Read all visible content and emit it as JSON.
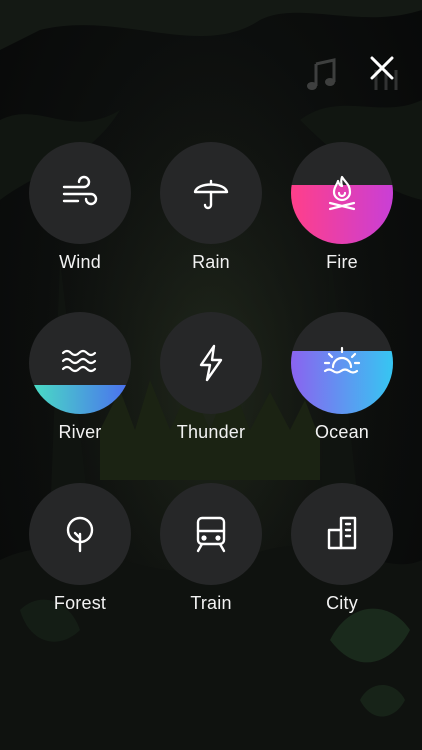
{
  "header": {
    "music_icon": "music-note-icon",
    "close_icon": "close-icon"
  },
  "sounds": [
    {
      "id": "wind",
      "label": "Wind",
      "icon": "wind-icon",
      "level": 0
    },
    {
      "id": "rain",
      "label": "Rain",
      "icon": "umbrella-icon",
      "level": 0
    },
    {
      "id": "fire",
      "label": "Fire",
      "icon": "campfire-icon",
      "level": 0.58,
      "gradient": [
        "#ff3f8a",
        "#c93fd6"
      ]
    },
    {
      "id": "river",
      "label": "River",
      "icon": "waves-icon",
      "level": 0.28,
      "gradient": [
        "#49e0c2",
        "#4b6df0"
      ]
    },
    {
      "id": "thunder",
      "label": "Thunder",
      "icon": "lightning-icon",
      "level": 0
    },
    {
      "id": "ocean",
      "label": "Ocean",
      "icon": "sunset-icon",
      "level": 0.62,
      "gradient": [
        "#8a63f0",
        "#36c6f2"
      ]
    },
    {
      "id": "forest",
      "label": "Forest",
      "icon": "tree-icon",
      "level": 0
    },
    {
      "id": "train",
      "label": "Train",
      "icon": "train-icon",
      "level": 0
    },
    {
      "id": "city",
      "label": "City",
      "icon": "building-icon",
      "level": 0
    }
  ]
}
